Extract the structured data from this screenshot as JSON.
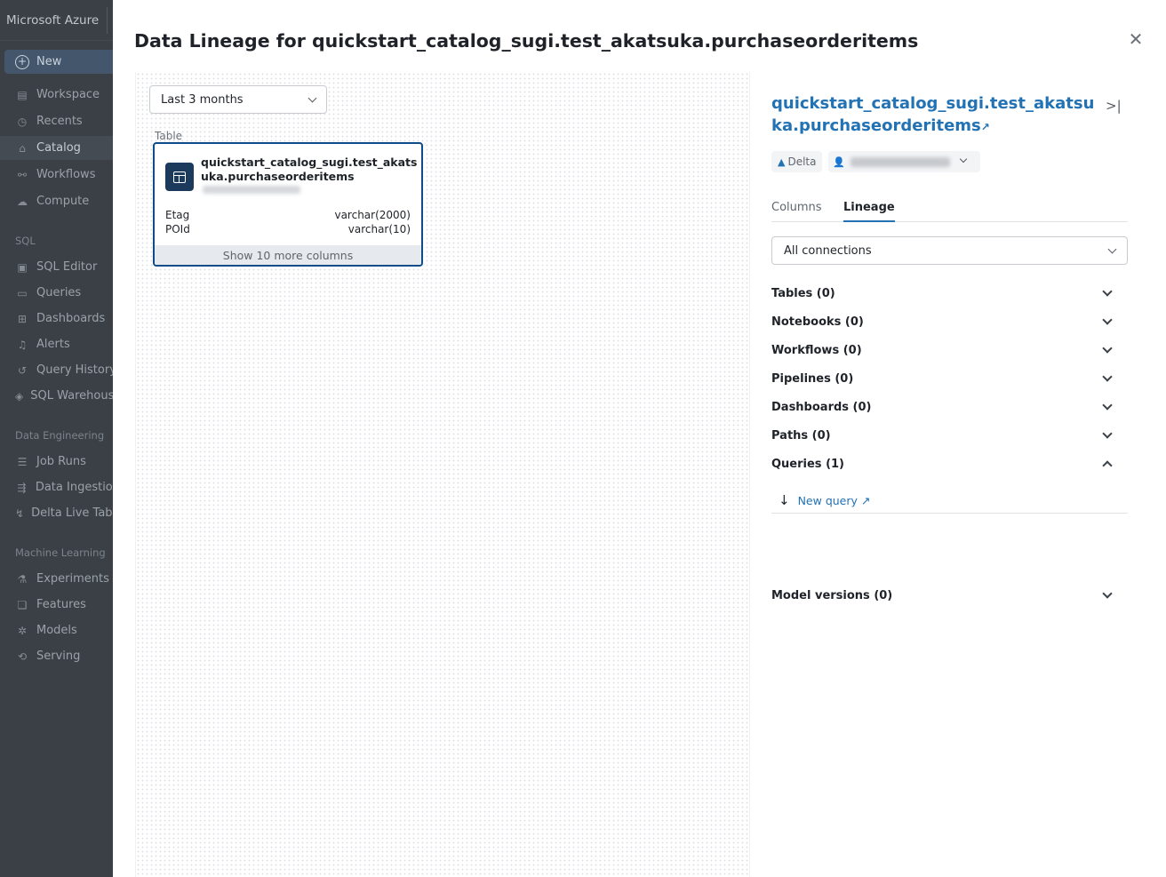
{
  "sidebar": {
    "brand": "Microsoft Azure",
    "new_label": "New",
    "items": [
      {
        "label": "Workspace",
        "icon": "workspace-icon",
        "glyph": "▤"
      },
      {
        "label": "Recents",
        "icon": "clock-icon",
        "glyph": "◷"
      },
      {
        "label": "Catalog",
        "icon": "catalog-icon",
        "glyph": "⌂"
      },
      {
        "label": "Workflows",
        "icon": "workflows-icon",
        "glyph": "⚯"
      },
      {
        "label": "Compute",
        "icon": "cloud-icon",
        "glyph": "☁"
      }
    ],
    "sql_section": "SQL",
    "sql_items": [
      {
        "label": "SQL Editor",
        "icon": "editor-icon",
        "glyph": "▣"
      },
      {
        "label": "Queries",
        "icon": "queries-icon",
        "glyph": "▭"
      },
      {
        "label": "Dashboards",
        "icon": "dashboards-icon",
        "glyph": "⊞"
      },
      {
        "label": "Alerts",
        "icon": "bell-icon",
        "glyph": "♫"
      },
      {
        "label": "Query History",
        "icon": "history-icon",
        "glyph": "↺"
      },
      {
        "label": "SQL Warehouses",
        "icon": "warehouse-icon",
        "glyph": "◈"
      }
    ],
    "de_section": "Data Engineering",
    "de_items": [
      {
        "label": "Job Runs",
        "icon": "job-runs-icon",
        "glyph": "☰"
      },
      {
        "label": "Data Ingestion",
        "icon": "ingestion-icon",
        "glyph": "⇶"
      },
      {
        "label": "Delta Live Tables",
        "icon": "delta-live-icon",
        "glyph": "↯"
      }
    ],
    "ml_section": "Machine Learning",
    "ml_items": [
      {
        "label": "Experiments",
        "icon": "experiments-icon",
        "glyph": "⚗"
      },
      {
        "label": "Features",
        "icon": "features-icon",
        "glyph": "❏"
      },
      {
        "label": "Models",
        "icon": "models-icon",
        "glyph": "✲"
      },
      {
        "label": "Serving",
        "icon": "serving-icon",
        "glyph": "⟲"
      }
    ]
  },
  "modal": {
    "title": "Data Lineage for quickstart_catalog_sugi.test_akatsuka.purchaseorderitems",
    "close_glyph": "✕"
  },
  "canvas": {
    "date_filter": "Last 3 months",
    "node": {
      "type_label": "Table",
      "name": "quickstart_catalog_sugi.test_akatsuka.purchaseorderitems",
      "columns": [
        {
          "name": "Etag",
          "type": "varchar(2000)"
        },
        {
          "name": "POId",
          "type": "varchar(10)"
        }
      ],
      "show_more": "Show 10 more columns"
    }
  },
  "panel": {
    "title": "quickstart_catalog_sugi.test_akatsuka.purchaseorderitems",
    "external_glyph": "↗",
    "collapse_glyph": ">|",
    "format_badge": "Delta",
    "tabs": [
      "Columns",
      "Lineage"
    ],
    "active_tab": "Lineage",
    "connections_filter": "All connections",
    "sections": [
      {
        "label": "Tables (0)",
        "expanded": false
      },
      {
        "label": "Notebooks (0)",
        "expanded": false
      },
      {
        "label": "Workflows (0)",
        "expanded": false
      },
      {
        "label": "Pipelines (0)",
        "expanded": false
      },
      {
        "label": "Dashboards (0)",
        "expanded": false
      },
      {
        "label": "Paths (0)",
        "expanded": false
      },
      {
        "label": "Queries (1)",
        "expanded": true
      }
    ],
    "query_item": "New query",
    "model_versions": "Model versions (0)"
  },
  "colors": {
    "accent": "#2272b4",
    "node_border": "#0f4d8a",
    "sidebar_bg": "#3b4046"
  }
}
